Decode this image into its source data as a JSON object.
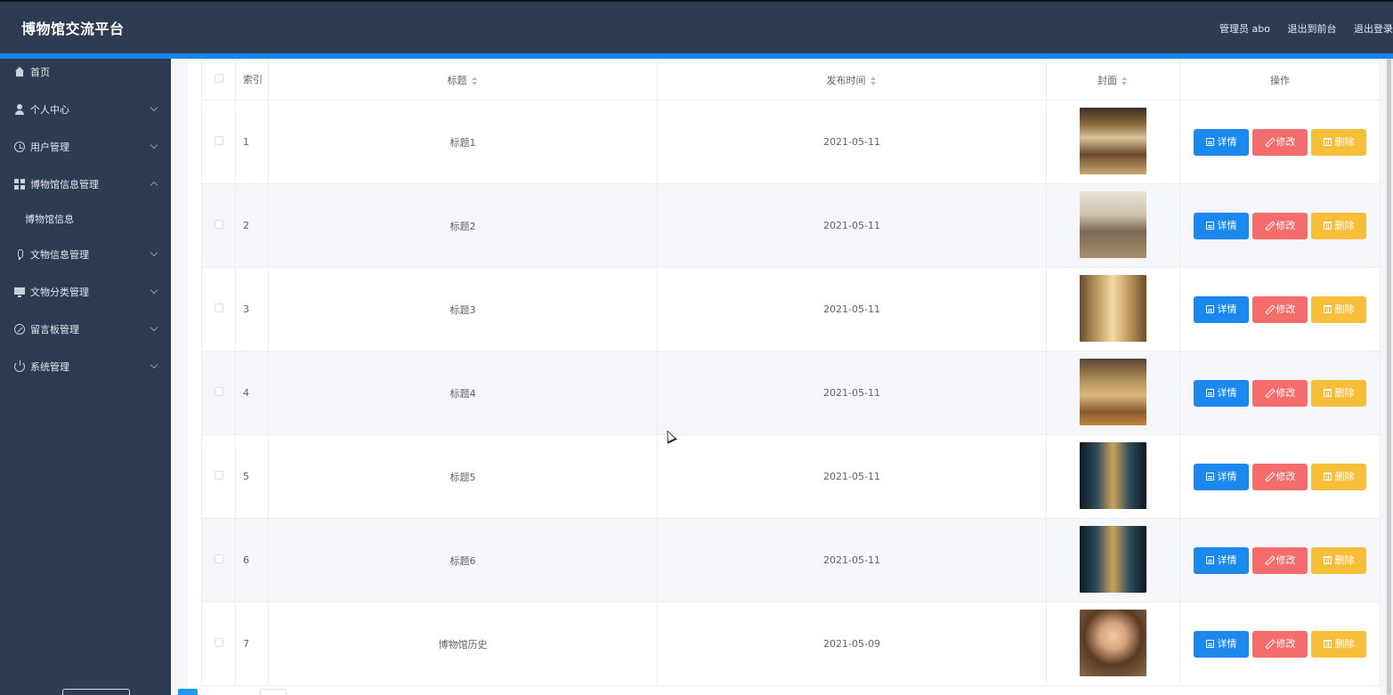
{
  "header": {
    "brand": "博物馆交流平台",
    "admin": "管理员 abo",
    "to_front": "退出到前台",
    "logout": "退出登录"
  },
  "sidebar": {
    "items": [
      {
        "label": "首页",
        "icon": "home-icon"
      },
      {
        "label": "个人中心",
        "icon": "user-icon",
        "expandable": true
      },
      {
        "label": "用户管理",
        "icon": "clock-icon",
        "expandable": true
      },
      {
        "label": "博物馆信息管理",
        "icon": "grid-icon",
        "expandable": true,
        "expanded": true
      },
      {
        "label": "博物馆信息",
        "submenu": true
      },
      {
        "label": "文物信息管理",
        "icon": "mic-icon",
        "expandable": true
      },
      {
        "label": "文物分类管理",
        "icon": "monitor-icon",
        "expandable": true
      },
      {
        "label": "留言板管理",
        "icon": "ball-icon",
        "expandable": true
      },
      {
        "label": "系统管理",
        "icon": "power-icon",
        "expandable": true
      }
    ]
  },
  "table": {
    "headers": {
      "index": "索引",
      "title": "标题",
      "date": "发布时间",
      "cover": "封面",
      "actions": "操作"
    },
    "rows": [
      {
        "index": "1",
        "title": "标题1",
        "date": "2021-05-11",
        "cover": "library-photo-warm"
      },
      {
        "index": "2",
        "title": "标题2",
        "date": "2021-05-11",
        "cover": "library-photo-light"
      },
      {
        "index": "3",
        "title": "标题3",
        "date": "2021-05-11",
        "cover": "library-photo-corridor"
      },
      {
        "index": "4",
        "title": "标题4",
        "date": "2021-05-11",
        "cover": "library-photo-reading-room"
      },
      {
        "index": "5",
        "title": "标题5",
        "date": "2021-05-11",
        "cover": "library-photo-dark-hall"
      },
      {
        "index": "6",
        "title": "标题6",
        "date": "2021-05-11",
        "cover": "library-photo-dark-hall"
      },
      {
        "index": "7",
        "title": "博物馆历史",
        "date": "2021-05-09",
        "cover": "portrait-photo"
      }
    ],
    "buttons": {
      "detail": "详情",
      "edit": "修改",
      "delete": "删除"
    }
  },
  "colors": {
    "topbar": "#2d3b53",
    "accent": "#1887e8",
    "detail": "#1a88ec",
    "edit": "#f56c6c",
    "delete": "#f7be3a"
  }
}
